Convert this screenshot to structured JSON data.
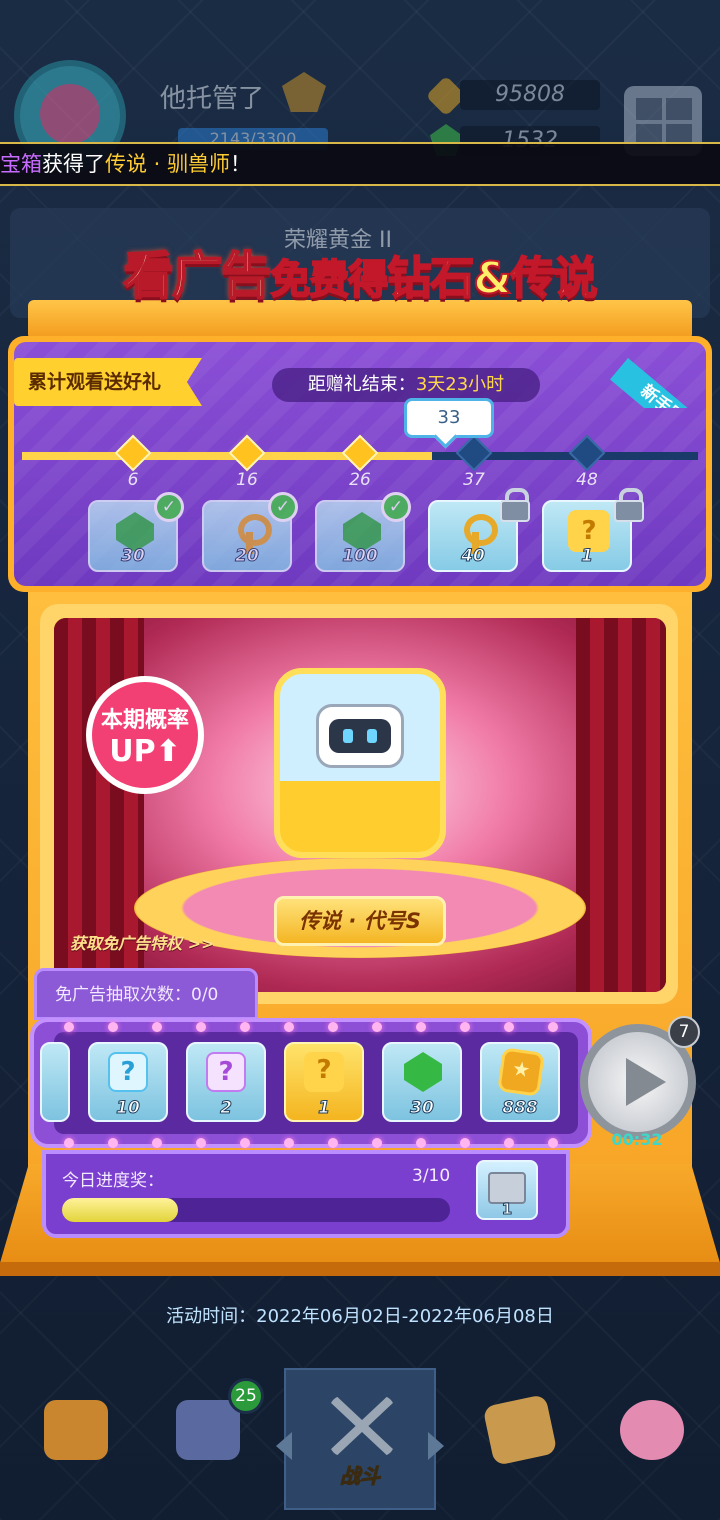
{
  "header": {
    "player_name": "他托管了",
    "xp_text": "2143/3300",
    "coins": "95808",
    "gems": "1532"
  },
  "marquee": {
    "part1": "宝箱",
    "part2": "获得了",
    "part3": "传说 · 驯兽师",
    "part4": "！"
  },
  "dim_card": {
    "rank_text": "荣耀黄金 II"
  },
  "banner": {
    "part1": "看广告",
    "part2": "免费得",
    "part3": "钻石&传说"
  },
  "milestones": {
    "ribbon": "累计观看送好礼",
    "countdown_label": "距赠礼结束：",
    "countdown_value": "3天23小时",
    "newbie_tag": "新手赠礼",
    "current": "33",
    "ticks": [
      "6",
      "16",
      "26",
      "37",
      "48"
    ],
    "rewards": [
      {
        "type": "gem",
        "count": "30",
        "status": "claimed"
      },
      {
        "type": "key",
        "count": "20",
        "status": "claimed"
      },
      {
        "type": "gem",
        "count": "100",
        "status": "claimed"
      },
      {
        "type": "key",
        "count": "40",
        "status": "locked"
      },
      {
        "type": "mystery-gold",
        "count": "1",
        "status": "locked"
      }
    ]
  },
  "stage": {
    "prob_line1": "本期概率",
    "prob_line2": "UP⬆",
    "featured_name": "传说 · 代号S",
    "adfree_link": "获取免广告特权 >>"
  },
  "draw": {
    "adfree_label": "免广告抽取次数：0/0",
    "reel": [
      {
        "type": "mystery-blue",
        "count": "10"
      },
      {
        "type": "mystery-purple",
        "count": "2"
      },
      {
        "type": "mystery-gold",
        "count": "1"
      },
      {
        "type": "gem",
        "count": "30"
      },
      {
        "type": "coin",
        "count": "888"
      }
    ],
    "play_count": "7",
    "play_timer": "00:32"
  },
  "daily_progress": {
    "label": "今日进度奖：",
    "count": "3/10",
    "fraction": 0.3,
    "chest_count": "1"
  },
  "event_time": "活动时间：2022年06月02日-2022年06月08日",
  "nav": {
    "badge": "25",
    "active_label": "战斗"
  },
  "colors": {
    "accent_orange": "#f7a526",
    "panel_purple": "#8c5ad6",
    "progress_yellow": "#fff29a"
  }
}
